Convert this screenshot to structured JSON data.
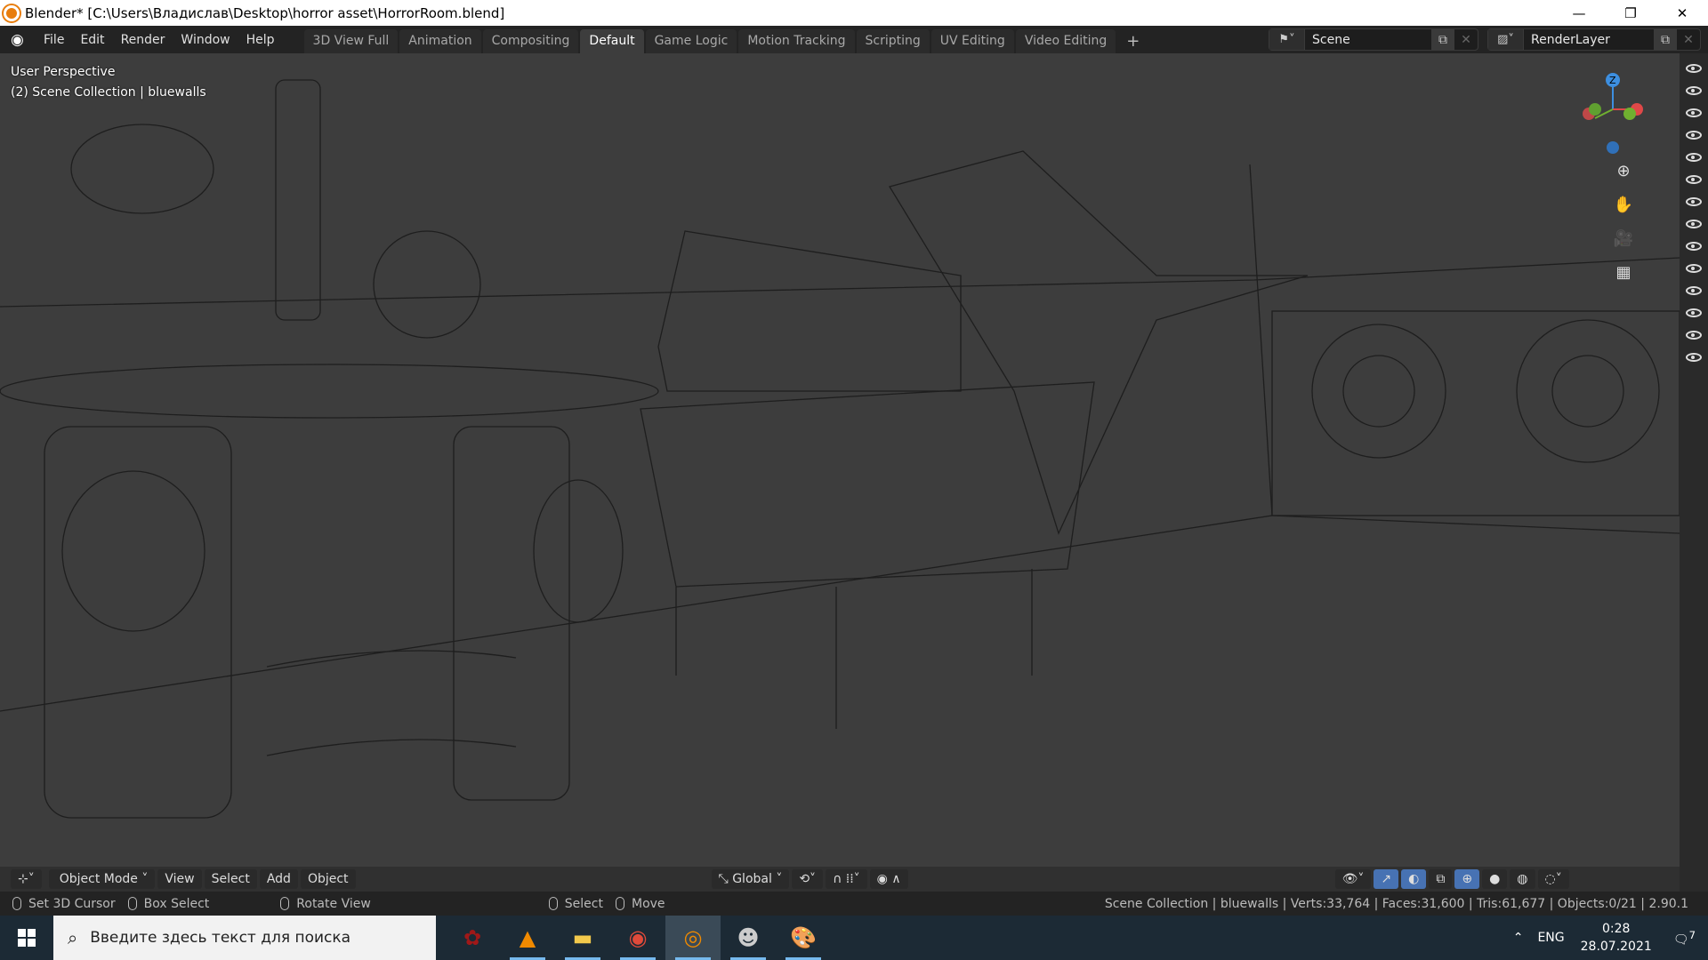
{
  "window": {
    "title": "Blender* [C:\\Users\\Владислав\\Desktop\\horror asset\\HorrorRoom.blend]",
    "minimize": "—",
    "restore": "❐",
    "close": "✕"
  },
  "menu": [
    "File",
    "Edit",
    "Render",
    "Window",
    "Help"
  ],
  "workspaces": [
    "3D View Full",
    "Animation",
    "Compositing",
    "Default",
    "Game Logic",
    "Motion Tracking",
    "Scripting",
    "UV Editing",
    "Video Editing"
  ],
  "active_workspace": "Default",
  "add_workspace": "+",
  "scene": {
    "name": "Scene"
  },
  "view_layer": {
    "name": "RenderLayer"
  },
  "viewport": {
    "perspective": "User Perspective",
    "collection": "(2) Scene Collection | bluewalls",
    "gizmo_axis": "Z"
  },
  "header3d": {
    "mode": "Object Mode",
    "menus": [
      "View",
      "Select",
      "Add",
      "Object"
    ],
    "orientation": "Global"
  },
  "status": {
    "hints": [
      "Set 3D Cursor",
      "Box Select",
      "Rotate View",
      "Select",
      "Move"
    ],
    "stats": "Scene Collection | bluewalls | Verts:33,764 | Faces:31,600 | Tris:61,677 | Objects:0/21 | 2.90.1"
  },
  "taskbar": {
    "search_placeholder": "Введите здесь текст для поиска",
    "lang": "ENG",
    "time": "0:28",
    "date": "28.07.2021",
    "notifications": "7"
  },
  "colors": {
    "accent": "#4772b3",
    "viewport": "#3d3d3d",
    "taskbar": "#1c2a35"
  }
}
